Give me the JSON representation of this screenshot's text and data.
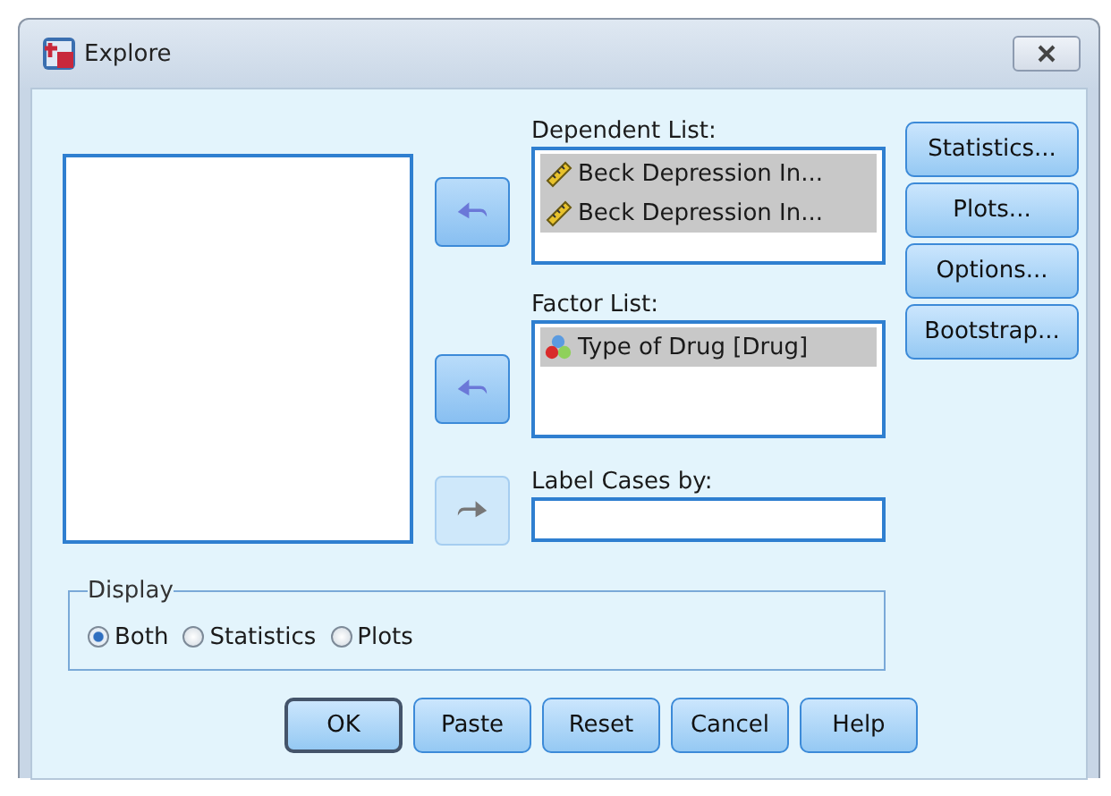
{
  "window": {
    "title": "Explore"
  },
  "move_buttons": [
    {
      "kind": "left",
      "disabled": false
    },
    {
      "kind": "left",
      "disabled": false
    },
    {
      "kind": "right",
      "disabled": true
    }
  ],
  "dependent_list": {
    "label": "Dependent List:",
    "items": [
      {
        "kind": "scale",
        "text": "Beck Depression In...",
        "selected": true
      },
      {
        "kind": "scale",
        "text": "Beck Depression In...",
        "selected": true
      }
    ]
  },
  "factor_list": {
    "label": "Factor List:",
    "items": [
      {
        "kind": "nominal",
        "text": "Type of Drug [Drug]",
        "selected": true
      }
    ]
  },
  "label_cases": {
    "label": "Label Cases by:"
  },
  "side_buttons": [
    "Statistics...",
    "Plots...",
    "Options...",
    "Bootstrap..."
  ],
  "display": {
    "title": "Display",
    "options": [
      {
        "label": "Both",
        "selected": true
      },
      {
        "label": "Statistics",
        "selected": false
      },
      {
        "label": "Plots",
        "selected": false
      }
    ]
  },
  "buttons": [
    {
      "label": "OK",
      "default": true
    },
    {
      "label": "Paste",
      "default": false
    },
    {
      "label": "Reset",
      "default": false
    },
    {
      "label": "Cancel",
      "default": false
    },
    {
      "label": "Help",
      "default": false
    }
  ]
}
